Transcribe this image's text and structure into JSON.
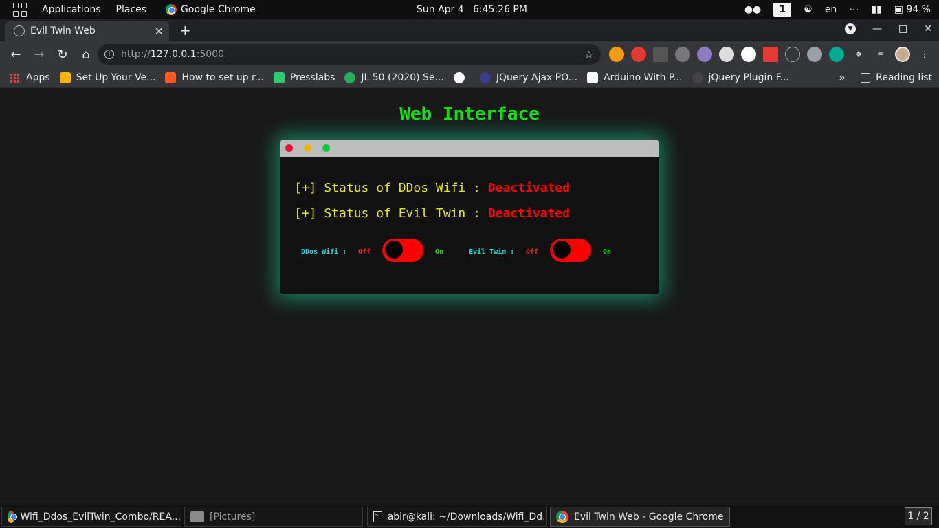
{
  "system_bar": {
    "applications": "Applications",
    "places": "Places",
    "active_app": "Google Chrome",
    "clock": "Sun Apr 4   6:45:26 PM",
    "workspace": "1",
    "lang": "en",
    "battery": "94 %"
  },
  "browser": {
    "tab_title": "Evil Twin Web",
    "url_scheme": "http://",
    "url_host": "127.0.0.1",
    "url_port": ":5000",
    "bookmarks": [
      {
        "label": "Apps",
        "color": "#ea4335"
      },
      {
        "label": "Set Up Your Ve...",
        "color": "#f4b400"
      },
      {
        "label": "How to set up r...",
        "color": "#ff5722"
      },
      {
        "label": "Presslabs",
        "color": "#2ecc71"
      },
      {
        "label": "JL 50 (2020) Se...",
        "color": "#27ae60"
      },
      {
        "label": "",
        "color": "#ffffff"
      },
      {
        "label": "JQuery Ajax PO...",
        "color": "#3b3b8f"
      },
      {
        "label": "Arduino With P...",
        "color": "#ffffff"
      },
      {
        "label": "jQuery Plugin F...",
        "color": "#444444"
      }
    ],
    "reading_list": "Reading list"
  },
  "page": {
    "title": "Web Interface",
    "status_ddos_label": "[+] Status of DDos Wifi : ",
    "status_ddos_value": "Deactivated",
    "status_evil_label": "[+] Status of Evil Twin : ",
    "status_evil_value": "Deactivated",
    "ddos_toggle_label": "DDos Wifi :",
    "evil_toggle_label": "Evil Twin :",
    "off_label": "Off",
    "on_label": "On"
  },
  "taskbar": {
    "items": [
      "Wifi_Ddos_EvilTwin_Combo/REA...",
      "[Pictures]",
      "abir@kali: ~/Downloads/Wifi_Dd...",
      "Evil Twin Web - Google Chrome"
    ],
    "pager": "1 / 2"
  },
  "colors": {
    "title_green": "#10e30c",
    "status_yellow": "#e9e900",
    "deactivated_red": "#ff0000",
    "glow": "#1ec896"
  }
}
